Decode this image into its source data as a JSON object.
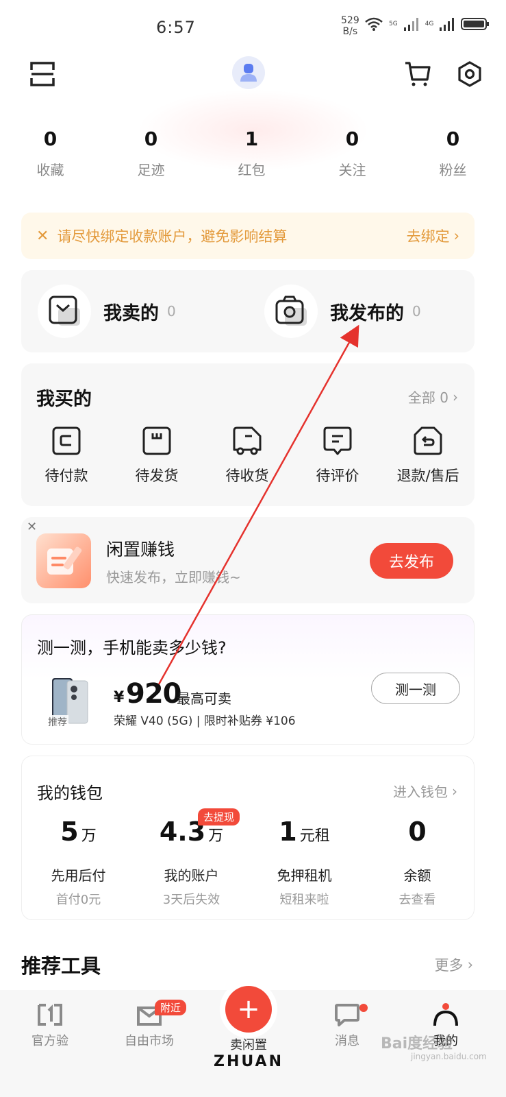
{
  "status_bar": {
    "time": "6:57",
    "net_speed_value": "529",
    "net_speed_unit": "B/s",
    "sim1": "5G",
    "sim2": "4G"
  },
  "header": {
    "scan_icon": "scan-icon",
    "avatar_icon": "user-avatar-icon",
    "cart_icon": "cart-icon",
    "settings_icon": "settings-icon"
  },
  "stats": [
    {
      "value": "0",
      "label": "收藏"
    },
    {
      "value": "0",
      "label": "足迹"
    },
    {
      "value": "1",
      "label": "红包"
    },
    {
      "value": "0",
      "label": "关注"
    },
    {
      "value": "0",
      "label": "粉丝"
    }
  ],
  "notice": {
    "text": "请尽快绑定收款账户，避免影响结算",
    "action": "去绑定"
  },
  "sell": {
    "sold_label": "我卖的",
    "sold_count": "0",
    "published_label": "我发布的",
    "published_count": "0"
  },
  "buy": {
    "title": "我买的",
    "all_label": "全部 0",
    "items": [
      {
        "label": "待付款",
        "icon": "wallet-icon"
      },
      {
        "label": "待发货",
        "icon": "package-icon"
      },
      {
        "label": "待收货",
        "icon": "truck-icon"
      },
      {
        "label": "待评价",
        "icon": "review-icon"
      },
      {
        "label": "退款/售后",
        "icon": "return-icon"
      }
    ]
  },
  "idle": {
    "title": "闲置赚钱",
    "subtitle": "快速发布，立即赚钱~",
    "button": "去发布"
  },
  "estimate": {
    "title": "测一测，手机能卖多少钱?",
    "tag": "推荐",
    "currency": "¥",
    "price": "920",
    "price_note": "最高可卖",
    "model_line": "荣耀 V40 (5G) | 限时补贴券 ¥106",
    "button": "测一测"
  },
  "wallet": {
    "title": "我的钱包",
    "enter": "进入钱包",
    "items": [
      {
        "big": "5",
        "unit": "万",
        "label": "先用后付",
        "sub": "首付0元",
        "badge": ""
      },
      {
        "big": "4.3",
        "unit": "万",
        "label": "我的账户",
        "sub": "3天后失效",
        "badge": "去提现"
      },
      {
        "big": "1",
        "unit": "元租",
        "label": "免押租机",
        "sub": "短租来啦",
        "badge": ""
      },
      {
        "big": "0",
        "unit": "",
        "label": "余额",
        "sub": "去查看",
        "badge": ""
      }
    ]
  },
  "tools": {
    "title": "推荐工具",
    "more": "更多"
  },
  "tabbar": {
    "official": "官方验",
    "market": "自由市场",
    "near_badge": "附近",
    "sell": "卖闲置",
    "sell_icon": "+",
    "messages": "消息",
    "mine": "我的",
    "brand": "ZHUAN"
  },
  "watermark": {
    "main": "Bai度经验",
    "sub": "jingyan.baidu.com"
  },
  "colors": {
    "accent_red": "#f24a3a",
    "notice_text": "#e39a3c",
    "annotation_arrow": "#e5322d"
  }
}
